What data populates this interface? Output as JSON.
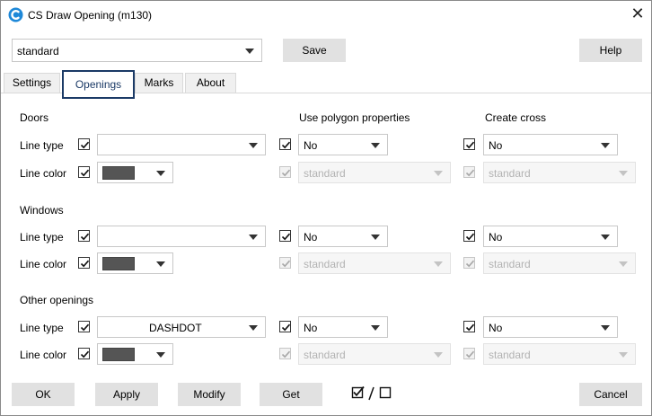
{
  "window": {
    "title": "CS Draw Opening (m130)",
    "close_glyph": "✕"
  },
  "preset": {
    "value": "standard"
  },
  "toolbar": {
    "save_label": "Save",
    "help_label": "Help"
  },
  "tabs": [
    {
      "label": "Settings"
    },
    {
      "label": "Openings"
    },
    {
      "label": "Marks"
    },
    {
      "label": "About"
    }
  ],
  "columns": {
    "use_polygon": "Use polygon properties",
    "create_cross": "Create cross"
  },
  "sections": [
    {
      "title": "Doors",
      "line_type_label": "Line type",
      "line_color_label": "Line color",
      "line_type_text": "",
      "polygon_value": "No",
      "polygon_sub": "standard",
      "cross_value": "No",
      "cross_sub": "standard"
    },
    {
      "title": "Windows",
      "line_type_label": "Line type",
      "line_color_label": "Line color",
      "line_type_text": "",
      "polygon_value": "No",
      "polygon_sub": "standard",
      "cross_value": "No",
      "cross_sub": "standard"
    },
    {
      "title": "Other openings",
      "line_type_label": "Line type",
      "line_color_label": "Line color",
      "line_type_text": "DASHDOT",
      "polygon_value": "No",
      "polygon_sub": "standard",
      "cross_value": "No",
      "cross_sub": "standard"
    }
  ],
  "footer": {
    "ok_label": "OK",
    "apply_label": "Apply",
    "modify_label": "Modify",
    "get_label": "Get",
    "cancel_label": "Cancel"
  },
  "colors": {
    "accent": "#1b3a66",
    "swatch": "#555555",
    "button_bg": "#e1e1e1"
  }
}
